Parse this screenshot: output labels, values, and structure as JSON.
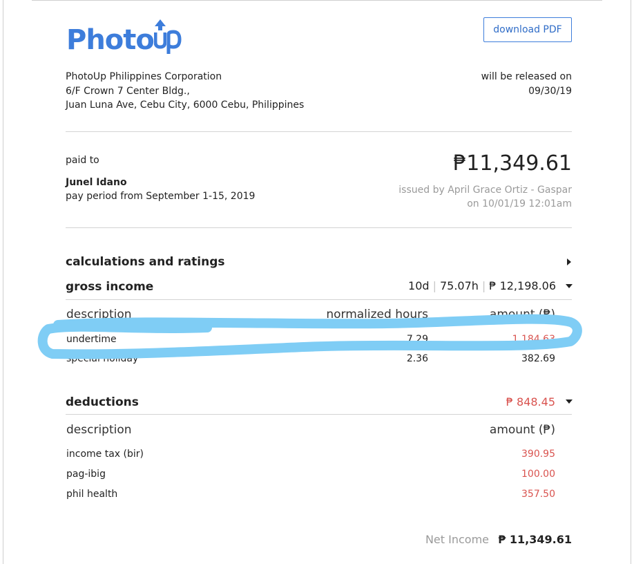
{
  "logo": {
    "text": "Photo",
    "suffix": "Up",
    "color": "#3d7ddb"
  },
  "toolbar": {
    "download_label": "download PDF"
  },
  "company": {
    "name": "PhotoUp Philippines Corporation",
    "address_line1": "6/F Crown 7 Center Bldg.,",
    "address_line2": "Juan Luna Ave, Cebu City, 6000 Cebu, Philippines"
  },
  "release": {
    "label": "will be released on",
    "date": "09/30/19"
  },
  "payee": {
    "paid_to_label": "paid to",
    "name": "Junel Idano",
    "pay_period": "pay period from September 1-15, 2019"
  },
  "amount": {
    "total": "₱11,349.61",
    "issued_by": "issued by April Grace Ortiz - Gaspar",
    "issued_on": "on 10/01/19 12:01am"
  },
  "calculations": {
    "title": "calculations and ratings"
  },
  "gross_income": {
    "title": "gross income",
    "days": "10d",
    "hours": "75.07h",
    "amount": "₱ 12,198.06",
    "headers": {
      "description": "description",
      "hours": "normalized hours",
      "amount": "amount (₱)"
    },
    "rows": [
      {
        "description": "undertime",
        "hours": "7.29",
        "amount": "1,184.63"
      },
      {
        "description": "special holiday",
        "hours": "2.36",
        "amount": "382.69"
      }
    ]
  },
  "deductions": {
    "title": "deductions",
    "amount": "₱ 848.45",
    "headers": {
      "description": "description",
      "amount": "amount (₱)"
    },
    "rows": [
      {
        "description": "income tax (bir)",
        "amount": "390.95"
      },
      {
        "description": "pag-ibig",
        "amount": "100.00"
      },
      {
        "description": "phil health",
        "amount": "357.50"
      }
    ]
  },
  "net_income": {
    "label": "Net Income",
    "value": "₱ 11,349.61"
  },
  "colors": {
    "accent": "#3d7ddb",
    "negative": "#d9534f",
    "highlight_stroke": "#7fcdf5",
    "muted": "#9a9a9a"
  }
}
